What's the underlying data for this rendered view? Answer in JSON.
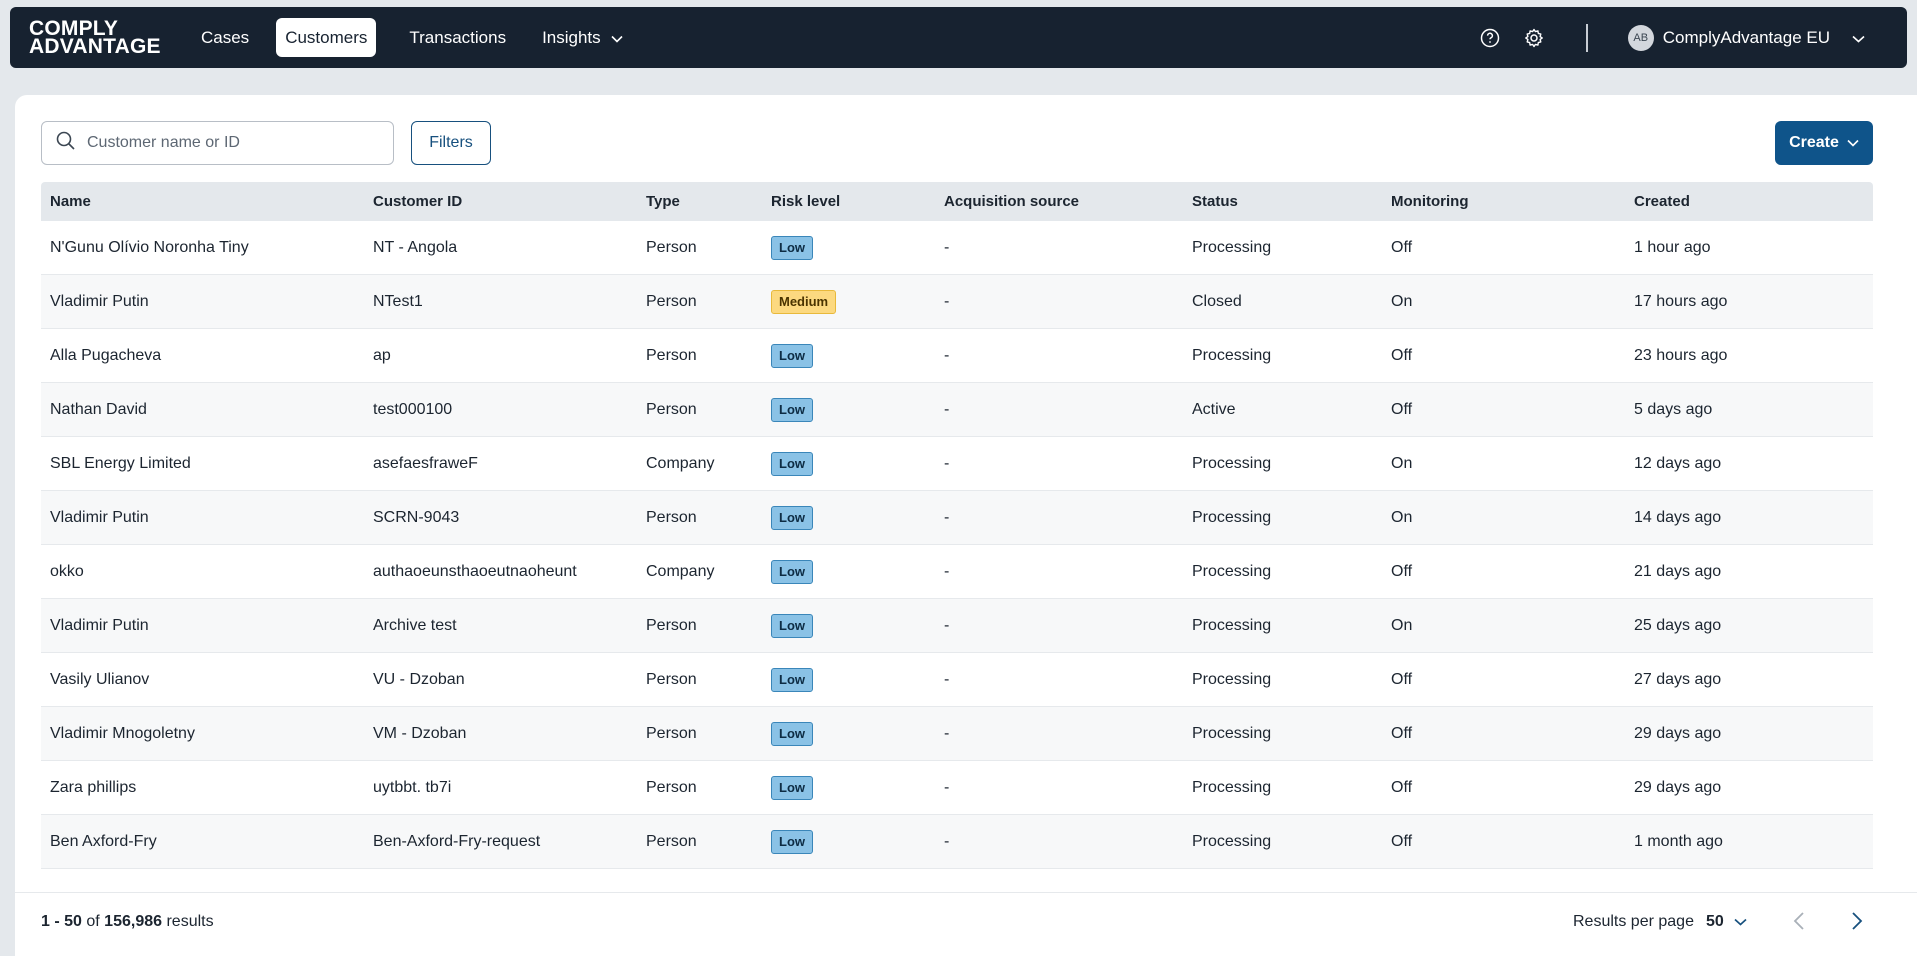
{
  "navbar": {
    "logo_line1": "COMPLY",
    "logo_line2": "ADVANTAGE",
    "links": [
      {
        "label": "Cases"
      },
      {
        "label": "Customers"
      },
      {
        "label": "Transactions"
      },
      {
        "label": "Insights"
      }
    ],
    "active_link": "Customers",
    "account_initials": "AB",
    "account_name": "ComplyAdvantage EU",
    "icons": [
      "help-icon",
      "gear-icon",
      "chevron-down-icon"
    ]
  },
  "toolbar": {
    "search_placeholder": "Customer name or ID",
    "filters_label": "Filters",
    "create_label": "Create"
  },
  "table": {
    "columns": [
      "Name",
      "Customer ID",
      "Type",
      "Risk level",
      "Acquisition source",
      "Status",
      "Monitoring",
      "Created"
    ],
    "rows": [
      {
        "name": "N'Gunu Olívio Noronha Tiny",
        "id": "NT - Angola",
        "type": "Person",
        "risk": "Low",
        "source": "-",
        "status": "Processing",
        "monitoring": "Off",
        "created": "1 hour ago"
      },
      {
        "name": "Vladimir Putin",
        "id": "NTest1",
        "type": "Person",
        "risk": "Medium",
        "source": "-",
        "status": "Closed",
        "monitoring": "On",
        "created": "17 hours ago"
      },
      {
        "name": "Alla Pugacheva",
        "id": "ap",
        "type": "Person",
        "risk": "Low",
        "source": "-",
        "status": "Processing",
        "monitoring": "Off",
        "created": "23 hours ago"
      },
      {
        "name": "Nathan David",
        "id": "test000100",
        "type": "Person",
        "risk": "Low",
        "source": "-",
        "status": "Active",
        "monitoring": "Off",
        "created": "5 days ago"
      },
      {
        "name": "SBL Energy Limited",
        "id": "asefaesfraweF",
        "type": "Company",
        "risk": "Low",
        "source": "-",
        "status": "Processing",
        "monitoring": "On",
        "created": "12 days ago"
      },
      {
        "name": "Vladimir Putin",
        "id": "SCRN-9043",
        "type": "Person",
        "risk": "Low",
        "source": "-",
        "status": "Processing",
        "monitoring": "On",
        "created": "14 days ago"
      },
      {
        "name": "okko",
        "id": "authaoeunsthaoeutnaoheunt",
        "type": "Company",
        "risk": "Low",
        "source": "-",
        "status": "Processing",
        "monitoring": "Off",
        "created": "21 days ago"
      },
      {
        "name": "Vladimir Putin",
        "id": "Archive test",
        "type": "Person",
        "risk": "Low",
        "source": "-",
        "status": "Processing",
        "monitoring": "On",
        "created": "25 days ago"
      },
      {
        "name": "Vasily Ulianov",
        "id": "VU - Dzoban",
        "type": "Person",
        "risk": "Low",
        "source": "-",
        "status": "Processing",
        "monitoring": "Off",
        "created": "27 days ago"
      },
      {
        "name": "Vladimir Mnogoletny",
        "id": "VM - Dzoban",
        "type": "Person",
        "risk": "Low",
        "source": "-",
        "status": "Processing",
        "monitoring": "Off",
        "created": "29 days ago"
      },
      {
        "name": "Zara phillips",
        "id": "uytbbt. tb7i",
        "type": "Person",
        "risk": "Low",
        "source": "-",
        "status": "Processing",
        "monitoring": "Off",
        "created": "29 days ago"
      },
      {
        "name": "Ben Axford-Fry",
        "id": "Ben-Axford-Fry-request",
        "type": "Person",
        "risk": "Low",
        "source": "-",
        "status": "Processing",
        "monitoring": "Off",
        "created": "1 month ago"
      }
    ]
  },
  "footer": {
    "range": "1 - 50",
    "of_label": "of",
    "total": "156,986",
    "results_label": "results",
    "per_page_label": "Results per page",
    "per_page_value": "50"
  },
  "colors": {
    "navbar_bg": "#172230",
    "primary": "#0f548a",
    "low_badge": "#8ac2e6",
    "medium_badge": "#fcd980"
  }
}
